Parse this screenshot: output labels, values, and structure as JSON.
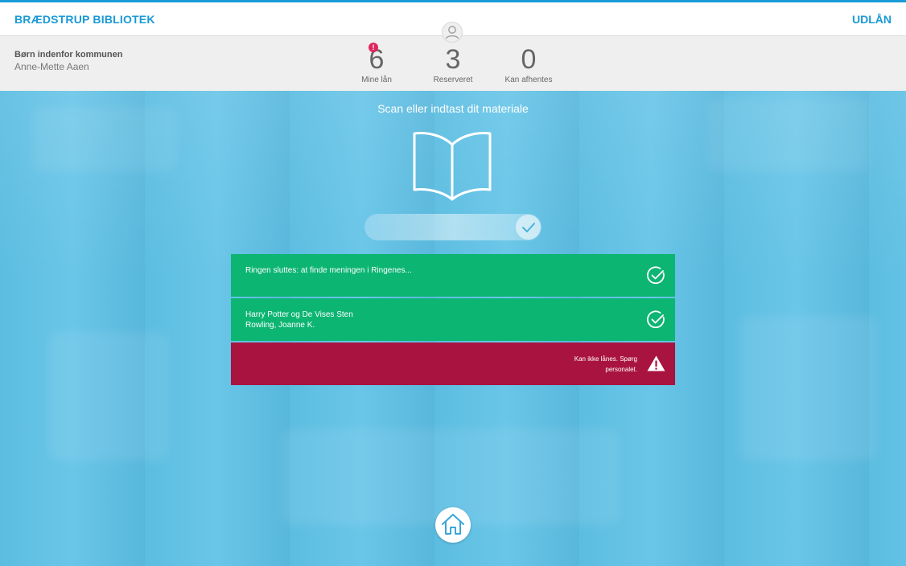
{
  "header": {
    "library_name": "BRÆDSTRUP BIBLIOTEK",
    "mode": "UDLÅN"
  },
  "patron": {
    "type": "Børn indenfor kommunen",
    "name": "Anne-Mette Aaen",
    "avatar_icon": "user-icon"
  },
  "stats": [
    {
      "value": "6",
      "label": "Mine lån",
      "alert": "!"
    },
    {
      "value": "3",
      "label": "Reserveret"
    },
    {
      "value": "0",
      "label": "Kan afhentes"
    }
  ],
  "scan": {
    "prompt": "Scan eller indtast dit materiale",
    "input_value": "",
    "book_icon": "open-book-icon",
    "submit_icon": "checkmark-icon"
  },
  "items": [
    {
      "title": "Ringen sluttes: at finde meningen i Ringenes...",
      "author": "",
      "status": "ok",
      "icon": "check-circle-icon"
    },
    {
      "title": "Harry Potter og De Vises Sten",
      "author": "Rowling, Joanne K.",
      "status": "ok",
      "icon": "check-circle-icon"
    },
    {
      "message": "Kan ikke lånes. Spørg personalet.",
      "status": "error",
      "icon": "warning-icon"
    }
  ],
  "footer": {
    "home_icon": "home-icon"
  },
  "colors": {
    "accent": "#1a9ad6",
    "success": "#0db573",
    "error": "#a9133f",
    "background": "#5fbfe3"
  }
}
